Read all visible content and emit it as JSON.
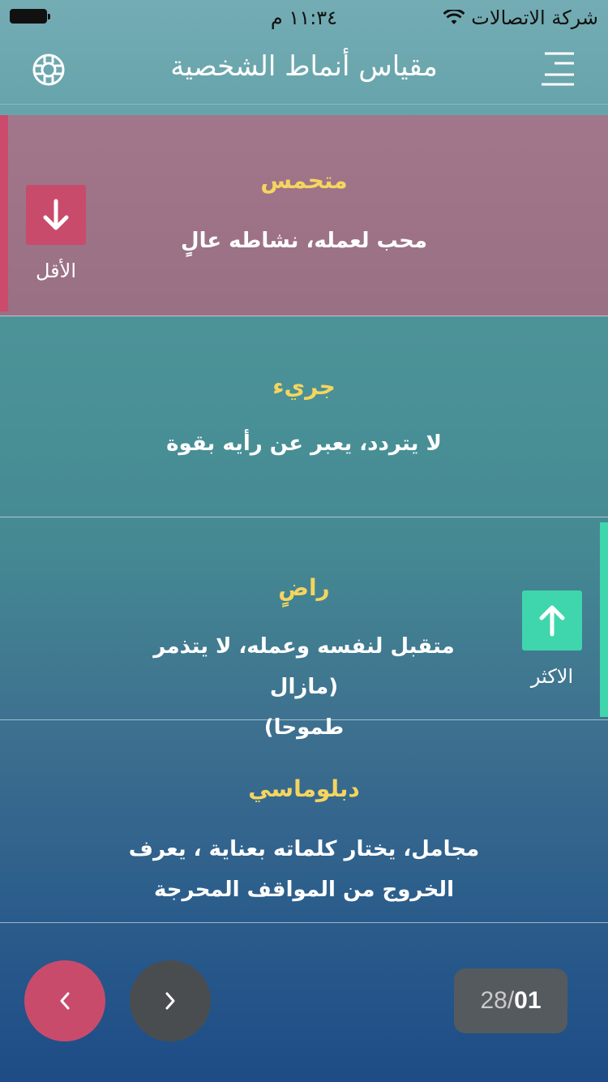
{
  "status_bar": {
    "time": "١١:٣٤ م",
    "carrier": "شركة الاتصالات"
  },
  "nav": {
    "title": "مقياس أنماط الشخصية",
    "left_icon": "lifebuoy-icon",
    "right_icon": "menu-icon"
  },
  "cards": [
    {
      "title": "متحمس",
      "description": "محب لعمله، نشاطه عالٍ",
      "rank": "least",
      "rank_label": "الأقل",
      "rank_icon": "arrow-down-icon",
      "accent_color": "#cc4a6c"
    },
    {
      "title": "جريء",
      "description": "لا يتردد، يعبر عن رأيه بقوة"
    },
    {
      "title": "راضٍ",
      "description_lines": [
        "متقبل لنفسه وعمله، لا يتذمر (مازال",
        "طموحا)"
      ],
      "rank": "most",
      "rank_label": "الاكثر",
      "rank_icon": "arrow-up-icon",
      "accent_color": "#3fd6ad"
    },
    {
      "title": "دبلوماسي",
      "description_lines": [
        "مجامل، يختار كلماته بعناية ، يعرف",
        "الخروج من المواقف المحرجة"
      ]
    }
  ],
  "pager": {
    "current": "01",
    "separator": "/",
    "total": "28",
    "prev_icon": "chevron-left-icon",
    "next_icon": "chevron-right-icon"
  }
}
